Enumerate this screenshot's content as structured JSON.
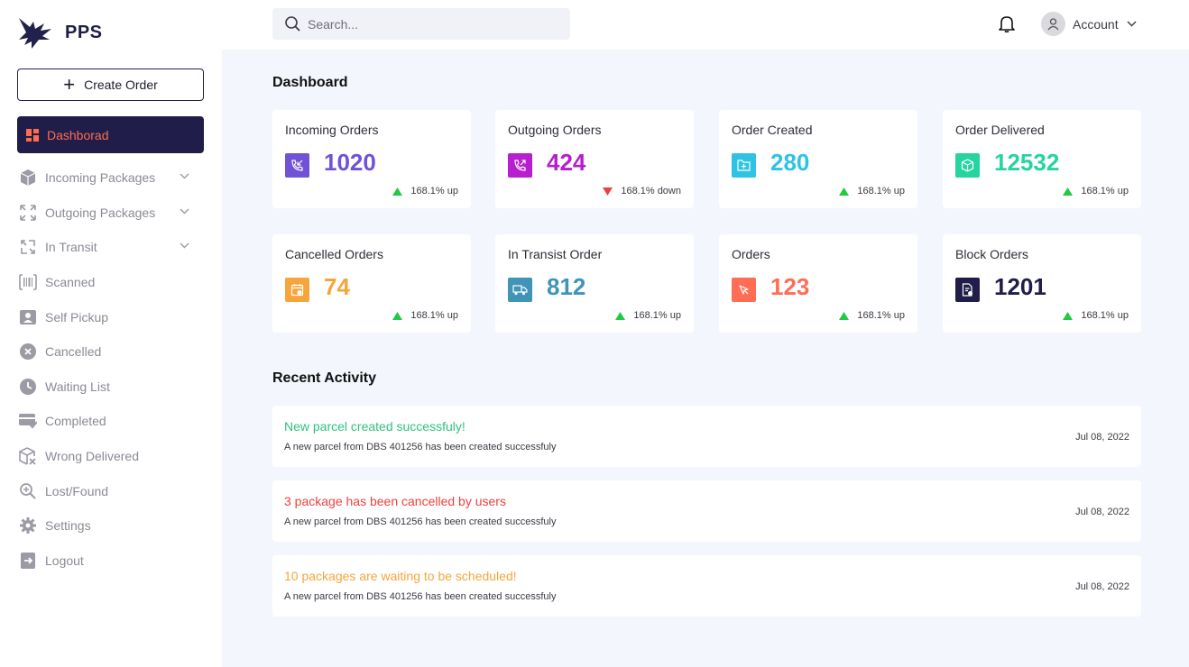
{
  "brand": {
    "name": "PPS",
    "colors": {
      "primary": "#201d4a",
      "accent": "#ff6d4d"
    }
  },
  "sidebar": {
    "create_label": "Create Order",
    "active": {
      "label": "Dashborad",
      "icon": "dashboard-grid-icon"
    },
    "items": [
      {
        "label": "Incoming Packages",
        "icon": "package-box-icon",
        "expandable": true
      },
      {
        "label": "Outgoing Packages",
        "icon": "expand-arrows-icon",
        "expandable": true
      },
      {
        "label": "In Transit",
        "icon": "transfer-arrows-icon",
        "expandable": true
      },
      {
        "label": "Scanned",
        "icon": "barcode-icon",
        "expandable": false
      },
      {
        "label": "Self Pickup",
        "icon": "user-card-icon",
        "expandable": false
      },
      {
        "label": "Cancelled",
        "icon": "x-circle-icon",
        "expandable": false
      },
      {
        "label": "Waiting List",
        "icon": "clock-icon",
        "expandable": false
      },
      {
        "label": "Completed",
        "icon": "check-tray-icon",
        "expandable": false
      },
      {
        "label": "Wrong Delivered",
        "icon": "box-x-icon",
        "expandable": false
      },
      {
        "label": "Lost/Found",
        "icon": "search-zoom-icon",
        "expandable": false
      },
      {
        "label": "Settings",
        "icon": "gear-icon",
        "expandable": false
      },
      {
        "label": "Logout",
        "icon": "logout-icon",
        "expandable": false
      }
    ]
  },
  "topbar": {
    "search_placeholder": "Search...",
    "account_label": "Account"
  },
  "dashboard": {
    "title": "Dashboard",
    "cards": [
      {
        "title": "Incoming Orders",
        "value": "1020",
        "trend": "168.1% up",
        "direction": "up",
        "color": "#7052d6",
        "icon": "phone-incoming-icon"
      },
      {
        "title": "Outgoing Orders",
        "value": "424",
        "trend": "168.1% down",
        "direction": "down",
        "color": "#b61ecf",
        "icon": "phone-outgoing-icon"
      },
      {
        "title": "Order Created",
        "value": "280",
        "trend": "168.1% up",
        "direction": "up",
        "color": "#2ec3e3",
        "icon": "folder-add-icon"
      },
      {
        "title": "Order Delivered",
        "value": "12532",
        "trend": "168.1% up",
        "direction": "up",
        "color": "#26d4a0",
        "icon": "cube-icon"
      },
      {
        "title": "Cancelled Orders",
        "value": "74",
        "trend": "168.1% up",
        "direction": "up",
        "color": "#f6a53c",
        "icon": "calendar-x-icon"
      },
      {
        "title": "In Transist Order",
        "value": "812",
        "trend": "168.1% up",
        "direction": "up",
        "color": "#3f94b8",
        "icon": "truck-icon"
      },
      {
        "title": "Orders",
        "value": "123",
        "trend": "168.1% up",
        "direction": "up",
        "color": "#ff6d55",
        "icon": "cursor-click-icon"
      },
      {
        "title": "Block Orders",
        "value": "1201",
        "trend": "168.1% up",
        "direction": "up",
        "color": "#201d4a",
        "icon": "document-block-icon"
      }
    ]
  },
  "recent_activity": {
    "title": "Recent Activity",
    "items": [
      {
        "title": "New parcel created successfuly!",
        "desc": "A new parcel from DBS 401256 has been created successfuly",
        "date": "Jul 08, 2022",
        "color": "#2ec27e"
      },
      {
        "title": "3 package has been cancelled by users",
        "desc": "A new parcel from DBS 401256 has been created successfuly",
        "date": "Jul 08, 2022",
        "color": "#f0403e"
      },
      {
        "title": "10 packages are waiting to be scheduled!",
        "desc": "A new parcel from DBS 401256 has been created successfuly",
        "date": "Jul 08, 2022",
        "color": "#f6a53c"
      }
    ]
  }
}
